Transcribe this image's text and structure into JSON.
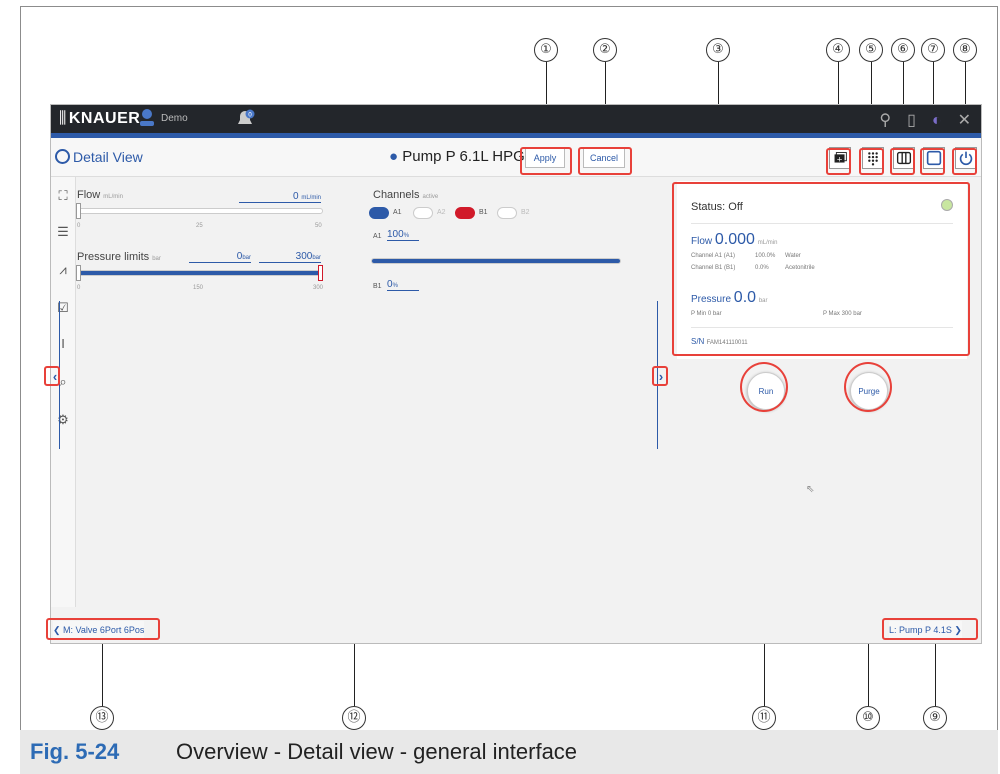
{
  "callouts": [
    "①",
    "②",
    "③",
    "④",
    "⑤",
    "⑥",
    "⑦",
    "⑧",
    "⑨",
    "⑩",
    "⑪",
    "⑫",
    "⑬"
  ],
  "topbar": {
    "brand": "KNAUER",
    "user": "Demo",
    "notification_count": "0"
  },
  "header": {
    "title": "Detail View",
    "device": "Pump P 6.1L HPG",
    "apply_label": "Apply",
    "cancel_label": "Cancel"
  },
  "flow": {
    "label": "Flow",
    "unit": "mL/min",
    "value": "0",
    "ticks": [
      "0",
      "25",
      "50"
    ],
    "level_fraction": 0
  },
  "pressure": {
    "label": "Pressure limits",
    "unit": "bar",
    "min_value": "0",
    "max_value": "300",
    "ticks": [
      "0",
      "150",
      "300"
    ]
  },
  "channels": {
    "label": "Channels",
    "sub": "active",
    "items": [
      {
        "name": "A1",
        "active": true,
        "color": "#2d5aa8"
      },
      {
        "name": "A2",
        "active": false
      },
      {
        "name": "B1",
        "active": true,
        "color": "#d11a2a"
      },
      {
        "name": "B2",
        "active": false
      }
    ],
    "a1_label": "A1",
    "a1_value": "100",
    "a1_unit": "%",
    "b1_label": "B1",
    "b1_value": "0",
    "b1_unit": "%"
  },
  "status": {
    "title": "Status: Off",
    "flow_label": "Flow",
    "flow_value": "0.000",
    "flow_unit": "mL/min",
    "channel_a1_label": "Channel A1 (A1)",
    "channel_a1_pct": "100.0%",
    "channel_a1_solvent": "Water",
    "channel_b1_label": "Channel B1 (B1)",
    "channel_b1_pct": "0.0%",
    "channel_b1_solvent": "Acetonitrile",
    "pressure_label": "Pressure",
    "pressure_value": "0.0",
    "pressure_unit": "bar",
    "pmin": "P Min  0 bar",
    "pmax": "P Max  300 bar",
    "sn_label": "S/N",
    "sn_value": "FAM141110011"
  },
  "actions": {
    "run_label": "Run",
    "purge_label": "Purge"
  },
  "nav": {
    "prev": "M: Valve 6Port 6Pos",
    "next": "L: Pump P 4.1S"
  },
  "caption": {
    "fig": "Fig. 5-24",
    "text": "Overview - Detail view - general interface"
  },
  "colors": {
    "accent": "#2d5aa8",
    "callout_box": "#e8413a",
    "caption_blue": "#2d6bb5"
  }
}
